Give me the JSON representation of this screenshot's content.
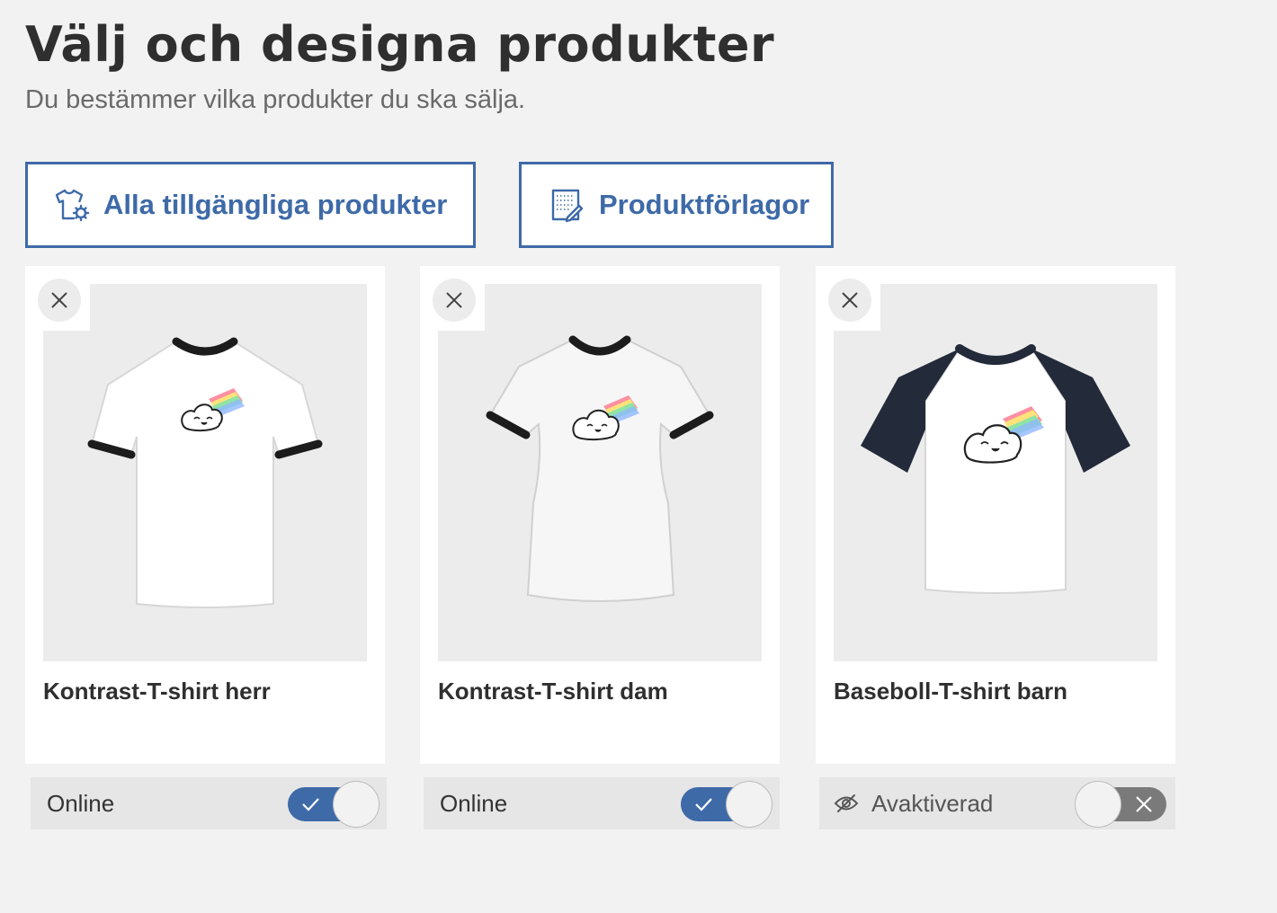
{
  "header": {
    "title": "Välj och designa produkter",
    "subtitle": "Du bestämmer vilka produkter du ska sälja."
  },
  "actions": {
    "all_products": {
      "label": "Alla tillgängliga produkter",
      "icon": "tshirt-gear-icon"
    },
    "templates": {
      "label": "Produktförlagor",
      "icon": "template-icon"
    }
  },
  "colors": {
    "accent": "#3e6aa8",
    "toggle_on": "#3e6aa8",
    "toggle_off": "#7a7a7a"
  },
  "products": [
    {
      "name": "Kontrast-T-shirt herr",
      "status": "Online",
      "enabled": true
    },
    {
      "name": "Kontrast-T-shirt dam",
      "status": "Online",
      "enabled": true
    },
    {
      "name": "Baseboll-T-shirt barn",
      "status": "Avaktiverad",
      "enabled": false
    }
  ]
}
